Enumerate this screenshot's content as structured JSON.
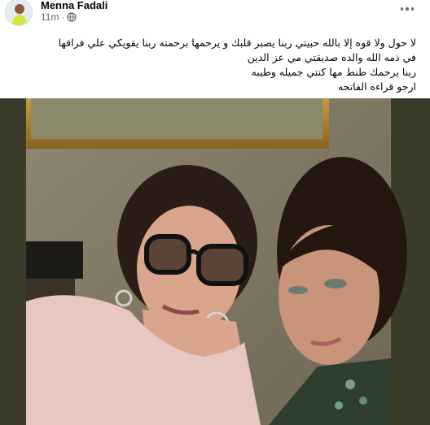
{
  "post": {
    "author": "Menna Fadali",
    "timestamp": "11m",
    "separator": "·",
    "privacy_icon": "globe-icon",
    "more_icon": "more-options-icon",
    "avatar_icon": "profile-avatar",
    "text_lines": [
      "لا حول ولا قوه إلا بالله حبيتي ربنا يصبر قلبك و يرحمها برحمته ربنا يقويكي علي فراقها",
      "في ذمه الله والده صديقتي مي عز الدين",
      "ربنا  يرحمك طنط مها كنتي جميله وطيبه",
      "ارجو قراءه الفاتحه"
    ],
    "photo_description_icon": "post-photo"
  },
  "colors": {
    "author": "#050505",
    "meta": "#65676b",
    "photo_background": "#3c3c2b"
  }
}
